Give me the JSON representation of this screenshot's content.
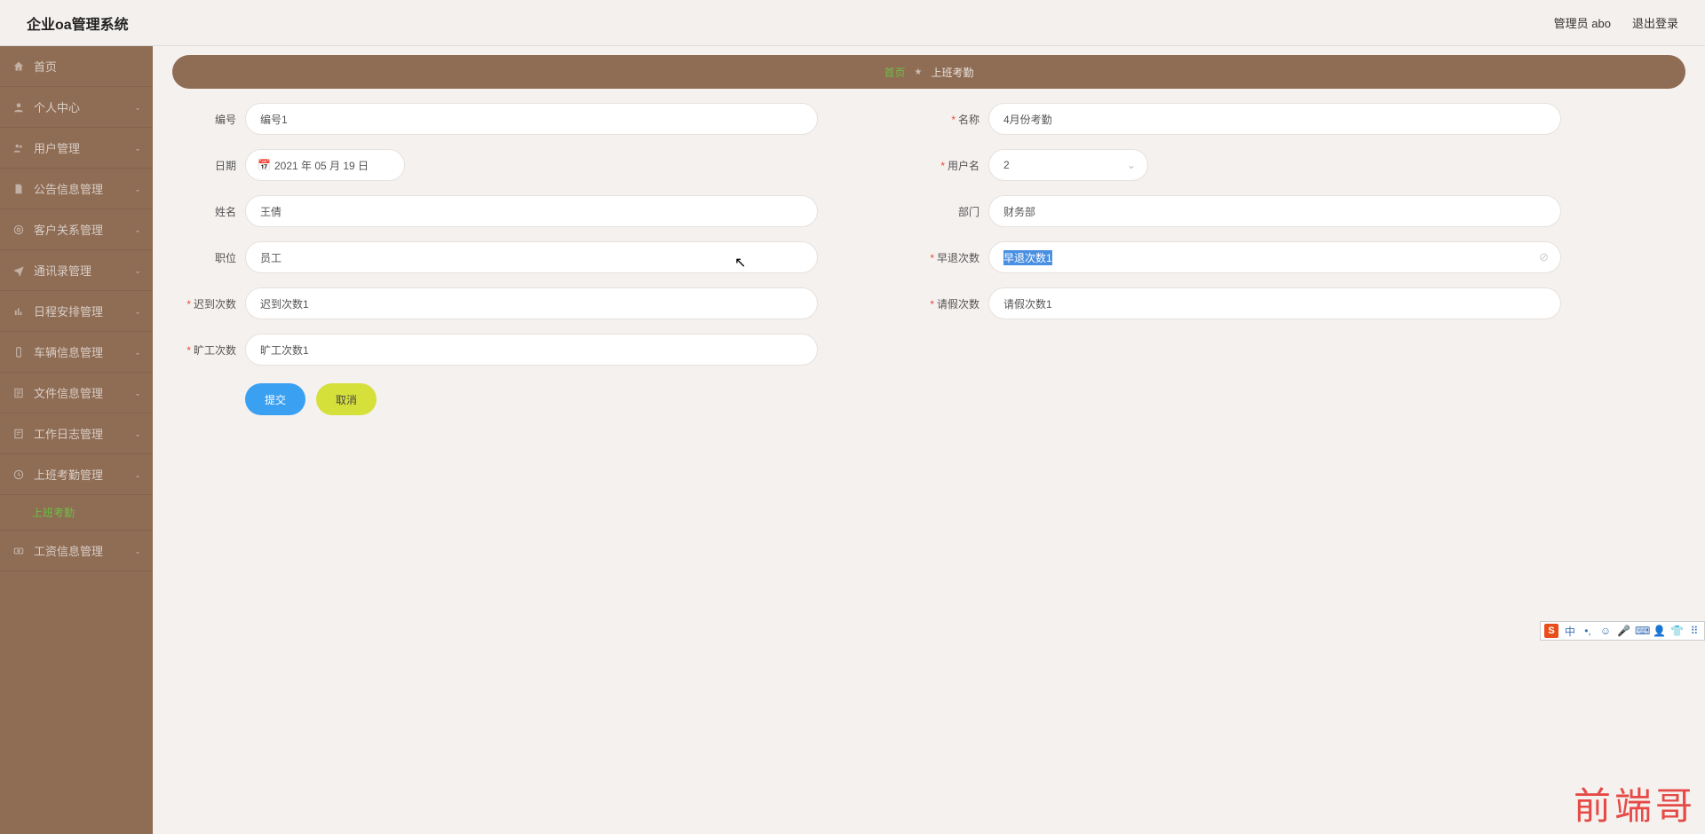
{
  "header": {
    "title": "企业oa管理系统",
    "user": "管理员 abo",
    "logout": "退出登录"
  },
  "sidebar": {
    "items": [
      {
        "label": "首页",
        "icon": "home",
        "expandable": false
      },
      {
        "label": "个人中心",
        "icon": "user",
        "expandable": true
      },
      {
        "label": "用户管理",
        "icon": "users",
        "expandable": true
      },
      {
        "label": "公告信息管理",
        "icon": "file",
        "expandable": true
      },
      {
        "label": "客户关系管理",
        "icon": "target",
        "expandable": true
      },
      {
        "label": "通讯录管理",
        "icon": "send",
        "expandable": true
      },
      {
        "label": "日程安排管理",
        "icon": "bars",
        "expandable": true
      },
      {
        "label": "车辆信息管理",
        "icon": "phone",
        "expandable": true
      },
      {
        "label": "文件信息管理",
        "icon": "doc",
        "expandable": true
      },
      {
        "label": "工作日志管理",
        "icon": "note",
        "expandable": true
      },
      {
        "label": "上班考勤管理",
        "icon": "clock",
        "expandable": true,
        "open": true,
        "children": [
          {
            "label": "上班考勤"
          }
        ]
      },
      {
        "label": "工资信息管理",
        "icon": "money",
        "expandable": true
      }
    ]
  },
  "breadcrumb": {
    "home": "首页",
    "sep": "★",
    "current": "上班考勤"
  },
  "form": {
    "fields": {
      "bianhao": {
        "label": "编号",
        "value": "编号1",
        "required": false
      },
      "mingcheng": {
        "label": "名称",
        "value": "4月份考勤",
        "required": true
      },
      "riqi": {
        "label": "日期",
        "value": "2021 年 05 月 19 日",
        "required": false
      },
      "yonghuming": {
        "label": "用户名",
        "value": "2",
        "required": true
      },
      "xingming": {
        "label": "姓名",
        "value": "王倩",
        "required": false
      },
      "bumen": {
        "label": "部门",
        "value": "财务部",
        "required": false
      },
      "zhiwei": {
        "label": "职位",
        "value": "员工",
        "required": false
      },
      "zaotui": {
        "label": "早退次数",
        "value": "早退次数1",
        "required": true
      },
      "chidao": {
        "label": "迟到次数",
        "value": "迟到次数1",
        "required": true
      },
      "qingjia": {
        "label": "请假次数",
        "value": "请假次数1",
        "required": true
      },
      "kuanggong": {
        "label": "旷工次数",
        "value": "旷工次数1",
        "required": true
      }
    },
    "buttons": {
      "submit": "提交",
      "cancel": "取消"
    }
  },
  "ime": {
    "logo": "S",
    "items": [
      "中",
      "•,",
      "☺",
      "🎤",
      "⌨",
      "👤",
      "👕",
      "⠿"
    ]
  },
  "watermark": "前端哥"
}
